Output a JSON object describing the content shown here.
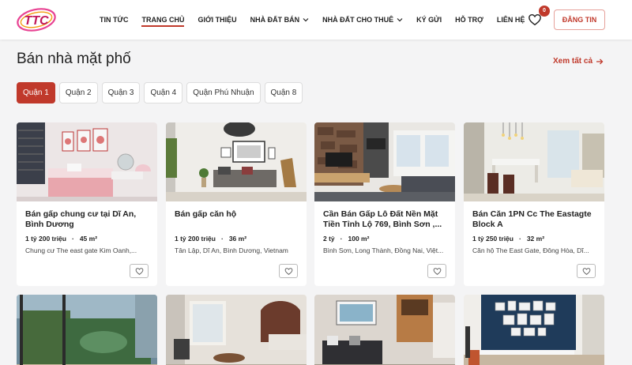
{
  "header": {
    "logo_text": "TTC",
    "nav": [
      {
        "label": "TIN TỨC",
        "dropdown": false,
        "active": false
      },
      {
        "label": "TRANG CHỦ",
        "dropdown": false,
        "active": true
      },
      {
        "label": "GIỚI THIỆU",
        "dropdown": false,
        "active": false
      },
      {
        "label": "NHÀ ĐẤT BÁN",
        "dropdown": true,
        "active": false
      },
      {
        "label": "NHÀ ĐẤT CHO THUÊ",
        "dropdown": true,
        "active": false
      },
      {
        "label": "KÝ GỬI",
        "dropdown": false,
        "active": false
      },
      {
        "label": "HỖ TRỢ",
        "dropdown": false,
        "active": false
      },
      {
        "label": "LIÊN HỆ",
        "dropdown": false,
        "active": false
      }
    ],
    "favorites_count": "0",
    "post_label": "ĐĂNG TIN"
  },
  "section": {
    "title": "Bán nhà mặt phố",
    "see_all": "Xem tất cả",
    "tabs": [
      {
        "label": "Quận 1",
        "active": true
      },
      {
        "label": "Quận 2",
        "active": false
      },
      {
        "label": "Quận 3",
        "active": false
      },
      {
        "label": "Quận 4",
        "active": false
      },
      {
        "label": "Quận Phú Nhuận",
        "active": false
      },
      {
        "label": "Quận 8",
        "active": false
      }
    ]
  },
  "listings": [
    {
      "title": "Bán gấp chung cư tại Dĩ An, Bình Dương",
      "price": "1 tỷ 200 triệu",
      "area": "45 m²",
      "address": "Chung cư The east gate Kim Oanh,..."
    },
    {
      "title": "Bán gấp căn hộ",
      "price": "1 tỷ 200 triệu",
      "area": "36 m²",
      "address": "Tân Lập, Dĩ An, Bình Dương, Vietnam"
    },
    {
      "title": "Cần Bán Gấp Lô Đất Nền Mặt Tiền Tỉnh Lộ 769, Bình Sơn ,...",
      "price": "2 tỷ",
      "area": "100 m²",
      "address": "Bình Sơn, Long Thành, Đồng Nai, Việt..."
    },
    {
      "title": "Bán Căn 1PN Cc The Eastagte Block A",
      "price": "1 tỷ 250 triệu",
      "area": "32 m²",
      "address": "Căn hộ The East Gate, Đông Hòa, Dĩ..."
    }
  ],
  "colors": {
    "accent": "#c0392b"
  }
}
